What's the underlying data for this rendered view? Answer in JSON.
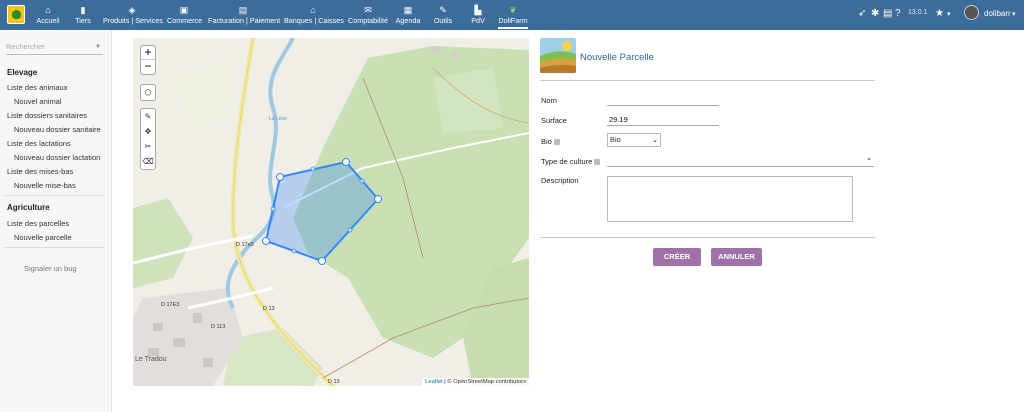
{
  "topbar": {
    "nav": [
      {
        "label": "Accueil",
        "icon": "home-icon"
      },
      {
        "label": "Tiers",
        "icon": "building-icon"
      },
      {
        "label": "Produits | Services",
        "icon": "cube-icon"
      },
      {
        "label": "Commerce",
        "icon": "briefcase-icon"
      },
      {
        "label": "Facturation | Paiement",
        "icon": "money-icon"
      },
      {
        "label": "Banques | Caisses",
        "icon": "bank-icon"
      },
      {
        "label": "Comptabilité",
        "icon": "ledger-icon"
      },
      {
        "label": "Agenda",
        "icon": "calendar-icon"
      },
      {
        "label": "Outils",
        "icon": "wrench-icon"
      },
      {
        "label": "PdV",
        "icon": "cash-register-icon"
      },
      {
        "label": "DoliFarm",
        "icon": "sprout-icon"
      }
    ],
    "version": "13.0.1",
    "username": "dolibarr"
  },
  "sidebar": {
    "search_placeholder": "Rechercher",
    "sections": [
      {
        "title": "Elevage",
        "items": [
          {
            "label": "Liste des animaux",
            "indent": false
          },
          {
            "label": "Nouvel animal",
            "indent": true
          },
          {
            "label": "Liste dossiers sanitaires",
            "indent": false
          },
          {
            "label": "Nouveau dossier sanitaire",
            "indent": true
          },
          {
            "label": "Liste des lactations",
            "indent": false
          },
          {
            "label": "Nouveau dossier lactation",
            "indent": true
          },
          {
            "label": "Liste des mises-bas",
            "indent": false
          },
          {
            "label": "Nouvelle mise-bas",
            "indent": true
          }
        ]
      },
      {
        "title": "Agriculture",
        "items": [
          {
            "label": "Liste des parcelles",
            "indent": false
          },
          {
            "label": "Nouvelle parcelle",
            "indent": true
          }
        ]
      }
    ],
    "bug_link": "Signaler un bug"
  },
  "map": {
    "zoom_in": "+",
    "zoom_out": "−",
    "attribution_leaflet": "Leaflet",
    "attribution_rest": " | © OpenStreetMap contributors",
    "labels": {
      "road1": "D 17e3",
      "road2": "D 17E3",
      "road3": "D 113",
      "road4": "D 13",
      "road5": "D 13",
      "town": "Le Tradou",
      "river": "La Lèze"
    }
  },
  "form": {
    "title": "Nouvelle Parcelle",
    "fields": {
      "nom_label": "Nom",
      "nom_value": "",
      "surface_label": "Surface",
      "surface_value": "29.19",
      "bio_label": "Bio",
      "bio_selected": "Bio",
      "culture_label": "Type de culture",
      "culture_selected": "",
      "description_label": "Description"
    },
    "create_button": "CRÉER",
    "cancel_button": "ANNULER"
  },
  "colors": {
    "topbar": "#3b6c9a",
    "button": "#a071a8",
    "title": "#2a6a8f",
    "polygon": "#3388ff"
  }
}
